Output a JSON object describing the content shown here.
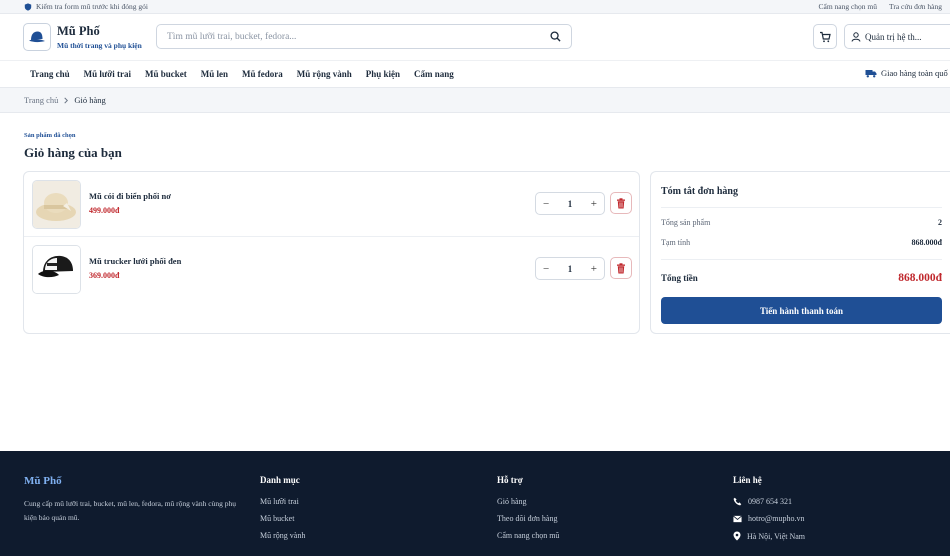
{
  "topbar": {
    "notice": "Kiểm tra form mũ trước khi đóng gói",
    "links": [
      "Cẩm nang chọn mũ",
      "Tra cứu đơn hàng"
    ]
  },
  "header": {
    "brand_name": "Mũ Phố",
    "brand_tagline": "Mũ thời trang và phụ kiện",
    "search_placeholder": "Tìm mũ lưỡi trai, bucket, fedora...",
    "admin_label": "Quản trị hệ th..."
  },
  "nav": {
    "items": [
      "Trang chủ",
      "Mũ lưỡi trai",
      "Mũ bucket",
      "Mũ len",
      "Mũ fedora",
      "Mũ rộng vành",
      "Phụ kiện",
      "Cẩm nang"
    ],
    "shipping": "Giao hàng toàn quố"
  },
  "breadcrumb": {
    "home": "Trang chủ",
    "current": "Giỏ hàng"
  },
  "page": {
    "eyebrow": "Sản phẩm đã chọn",
    "title": "Giỏ hàng của bạn"
  },
  "cart": {
    "items": [
      {
        "name": "Mũ cói đi biển phối nơ",
        "price": "499.000đ",
        "qty": "1"
      },
      {
        "name": "Mũ trucker lưới phối đen",
        "price": "369.000đ",
        "qty": "1"
      }
    ],
    "minus": "−",
    "plus": "+"
  },
  "summary": {
    "title": "Tóm tắt đơn hàng",
    "count_label": "Tổng sản phẩm",
    "count_value": "2",
    "subtotal_label": "Tạm tính",
    "subtotal_value": "868.000đ",
    "total_label": "Tổng tiền",
    "total_value": "868.000đ",
    "checkout_label": "Tiến hành thanh toán"
  },
  "footer": {
    "brand": "Mũ Phố",
    "about": "Cung cấp mũ lưỡi trai, bucket, mũ len, fedora, mũ rộng vành cùng phụ kiện bảo quản mũ.",
    "categories_title": "Danh mục",
    "categories": [
      "Mũ lưỡi trai",
      "Mũ bucket",
      "Mũ rộng vành"
    ],
    "support_title": "Hỗ trợ",
    "support": [
      "Giỏ hàng",
      "Theo dõi đơn hàng",
      "Cẩm nang chọn mũ"
    ],
    "contact_title": "Liên hệ",
    "phone": "0987 654 321",
    "email": "hotro@mupho.vn",
    "address": "Hà Nội, Việt Nam"
  },
  "colors": {
    "primary": "#1f4f95",
    "price": "#c0282d",
    "footer_bg": "#0f1b2e"
  }
}
